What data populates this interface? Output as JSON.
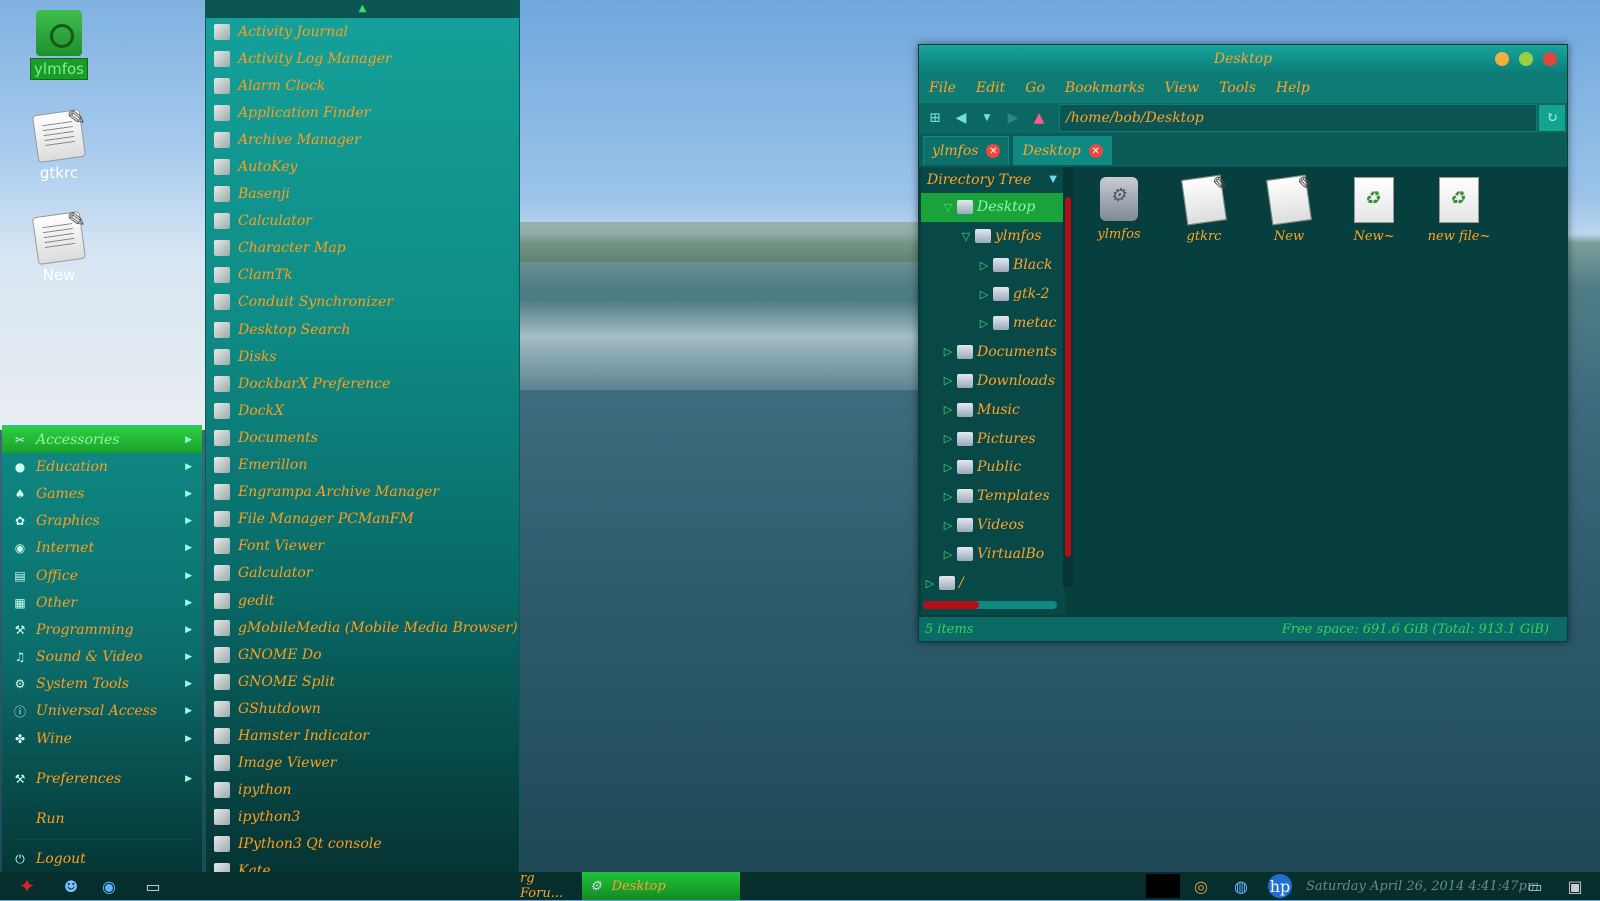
{
  "desktop": {
    "icons": [
      {
        "label": "ylmfos",
        "icon": "folder-icon"
      },
      {
        "label": "gtkrc",
        "icon": "document-icon"
      },
      {
        "label": "New",
        "icon": "document-icon"
      }
    ]
  },
  "main_menu": {
    "items": [
      {
        "label": "Accessories",
        "icon": "accessories-icon"
      },
      {
        "label": "Education",
        "icon": "education-icon"
      },
      {
        "label": "Games",
        "icon": "games-icon"
      },
      {
        "label": "Graphics",
        "icon": "graphics-icon"
      },
      {
        "label": "Internet",
        "icon": "internet-icon"
      },
      {
        "label": "Office",
        "icon": "office-icon"
      },
      {
        "label": "Other",
        "icon": "other-icon"
      },
      {
        "label": "Programming",
        "icon": "programming-icon"
      },
      {
        "label": "Sound & Video",
        "icon": "sound-video-icon"
      },
      {
        "label": "System Tools",
        "icon": "system-tools-icon"
      },
      {
        "label": "Universal Access",
        "icon": "universal-access-icon"
      },
      {
        "label": "Wine",
        "icon": "wine-icon"
      }
    ],
    "preferences": "Preferences",
    "run": "Run",
    "logout": "Logout"
  },
  "submenu": {
    "items": [
      "Activity Journal",
      "Activity Log Manager",
      "Alarm Clock",
      "Application Finder",
      "Archive Manager",
      "AutoKey",
      "Basenji",
      "Calculator",
      "Character Map",
      "ClamTk",
      "Conduit Synchronizer",
      "Desktop Search",
      "Disks",
      "DockbarX Preference",
      "DockX",
      "Documents",
      "Emerillon",
      "Engrampa Archive Manager",
      "File Manager PCManFM",
      "Font Viewer",
      "Galculator",
      "gedit",
      "gMobileMedia (Mobile Media Browser)",
      "GNOME Do",
      "GNOME Split",
      "GShutdown",
      "Hamster Indicator",
      "Image Viewer",
      "ipython",
      "ipython3",
      "IPython3 Qt console",
      "Kate"
    ]
  },
  "file_manager": {
    "title": "Desktop",
    "menu": [
      "File",
      "Edit",
      "Go",
      "Bookmarks",
      "View",
      "Tools",
      "Help"
    ],
    "path": "/home/bob/Desktop",
    "tabs": [
      "ylmfos",
      "Desktop"
    ],
    "tree_header": "Directory Tree",
    "tree": [
      {
        "label": "Desktop"
      },
      {
        "label": "ylmfos"
      },
      {
        "label": "Black"
      },
      {
        "label": "gtk-2"
      },
      {
        "label": "metac"
      },
      {
        "label": "Documents"
      },
      {
        "label": "Downloads"
      },
      {
        "label": "Music"
      },
      {
        "label": "Pictures"
      },
      {
        "label": "Public"
      },
      {
        "label": "Templates"
      },
      {
        "label": "Videos"
      },
      {
        "label": "VirtualBo"
      },
      {
        "label": "/"
      }
    ],
    "files": [
      {
        "label": "ylmfos",
        "icon": "folder-icon"
      },
      {
        "label": "gtkrc",
        "icon": "text-file-icon"
      },
      {
        "label": "New",
        "icon": "text-file-icon"
      },
      {
        "label": "New~",
        "icon": "backup-file-icon"
      },
      {
        "label": "new file~",
        "icon": "backup-file-icon"
      }
    ],
    "status_left": "5 items",
    "status_right": "Free space: 691.6 GiB (Total: 913.1 GiB)"
  },
  "taskbar": {
    "tasks": [
      "rg Foru...",
      "Desktop"
    ],
    "clock": "Saturday April 26, 2014   4:41:47pm"
  },
  "colors": {
    "menu_text": "#ff9e1e",
    "accent_green": "#1b9b2a",
    "teal": "#0f8c86"
  }
}
